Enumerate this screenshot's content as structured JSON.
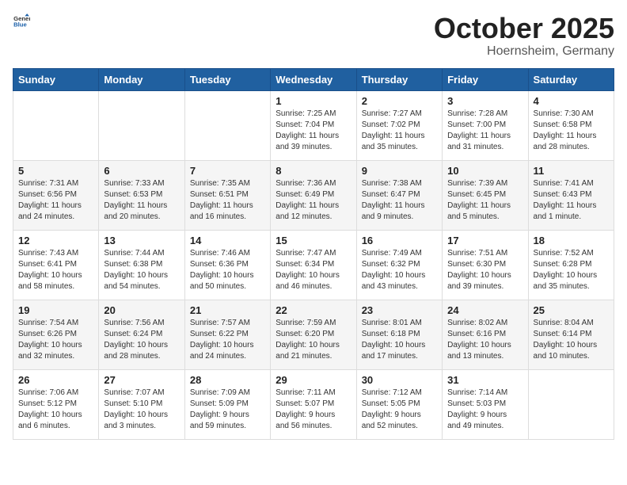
{
  "header": {
    "logo_general": "General",
    "logo_blue": "Blue",
    "month": "October 2025",
    "location": "Hoernsheim, Germany"
  },
  "weekdays": [
    "Sunday",
    "Monday",
    "Tuesday",
    "Wednesday",
    "Thursday",
    "Friday",
    "Saturday"
  ],
  "weeks": [
    [
      {
        "day": "",
        "info": ""
      },
      {
        "day": "",
        "info": ""
      },
      {
        "day": "",
        "info": ""
      },
      {
        "day": "1",
        "info": "Sunrise: 7:25 AM\nSunset: 7:04 PM\nDaylight: 11 hours\nand 39 minutes."
      },
      {
        "day": "2",
        "info": "Sunrise: 7:27 AM\nSunset: 7:02 PM\nDaylight: 11 hours\nand 35 minutes."
      },
      {
        "day": "3",
        "info": "Sunrise: 7:28 AM\nSunset: 7:00 PM\nDaylight: 11 hours\nand 31 minutes."
      },
      {
        "day": "4",
        "info": "Sunrise: 7:30 AM\nSunset: 6:58 PM\nDaylight: 11 hours\nand 28 minutes."
      }
    ],
    [
      {
        "day": "5",
        "info": "Sunrise: 7:31 AM\nSunset: 6:56 PM\nDaylight: 11 hours\nand 24 minutes."
      },
      {
        "day": "6",
        "info": "Sunrise: 7:33 AM\nSunset: 6:53 PM\nDaylight: 11 hours\nand 20 minutes."
      },
      {
        "day": "7",
        "info": "Sunrise: 7:35 AM\nSunset: 6:51 PM\nDaylight: 11 hours\nand 16 minutes."
      },
      {
        "day": "8",
        "info": "Sunrise: 7:36 AM\nSunset: 6:49 PM\nDaylight: 11 hours\nand 12 minutes."
      },
      {
        "day": "9",
        "info": "Sunrise: 7:38 AM\nSunset: 6:47 PM\nDaylight: 11 hours\nand 9 minutes."
      },
      {
        "day": "10",
        "info": "Sunrise: 7:39 AM\nSunset: 6:45 PM\nDaylight: 11 hours\nand 5 minutes."
      },
      {
        "day": "11",
        "info": "Sunrise: 7:41 AM\nSunset: 6:43 PM\nDaylight: 11 hours\nand 1 minute."
      }
    ],
    [
      {
        "day": "12",
        "info": "Sunrise: 7:43 AM\nSunset: 6:41 PM\nDaylight: 10 hours\nand 58 minutes."
      },
      {
        "day": "13",
        "info": "Sunrise: 7:44 AM\nSunset: 6:38 PM\nDaylight: 10 hours\nand 54 minutes."
      },
      {
        "day": "14",
        "info": "Sunrise: 7:46 AM\nSunset: 6:36 PM\nDaylight: 10 hours\nand 50 minutes."
      },
      {
        "day": "15",
        "info": "Sunrise: 7:47 AM\nSunset: 6:34 PM\nDaylight: 10 hours\nand 46 minutes."
      },
      {
        "day": "16",
        "info": "Sunrise: 7:49 AM\nSunset: 6:32 PM\nDaylight: 10 hours\nand 43 minutes."
      },
      {
        "day": "17",
        "info": "Sunrise: 7:51 AM\nSunset: 6:30 PM\nDaylight: 10 hours\nand 39 minutes."
      },
      {
        "day": "18",
        "info": "Sunrise: 7:52 AM\nSunset: 6:28 PM\nDaylight: 10 hours\nand 35 minutes."
      }
    ],
    [
      {
        "day": "19",
        "info": "Sunrise: 7:54 AM\nSunset: 6:26 PM\nDaylight: 10 hours\nand 32 minutes."
      },
      {
        "day": "20",
        "info": "Sunrise: 7:56 AM\nSunset: 6:24 PM\nDaylight: 10 hours\nand 28 minutes."
      },
      {
        "day": "21",
        "info": "Sunrise: 7:57 AM\nSunset: 6:22 PM\nDaylight: 10 hours\nand 24 minutes."
      },
      {
        "day": "22",
        "info": "Sunrise: 7:59 AM\nSunset: 6:20 PM\nDaylight: 10 hours\nand 21 minutes."
      },
      {
        "day": "23",
        "info": "Sunrise: 8:01 AM\nSunset: 6:18 PM\nDaylight: 10 hours\nand 17 minutes."
      },
      {
        "day": "24",
        "info": "Sunrise: 8:02 AM\nSunset: 6:16 PM\nDaylight: 10 hours\nand 13 minutes."
      },
      {
        "day": "25",
        "info": "Sunrise: 8:04 AM\nSunset: 6:14 PM\nDaylight: 10 hours\nand 10 minutes."
      }
    ],
    [
      {
        "day": "26",
        "info": "Sunrise: 7:06 AM\nSunset: 5:12 PM\nDaylight: 10 hours\nand 6 minutes."
      },
      {
        "day": "27",
        "info": "Sunrise: 7:07 AM\nSunset: 5:10 PM\nDaylight: 10 hours\nand 3 minutes."
      },
      {
        "day": "28",
        "info": "Sunrise: 7:09 AM\nSunset: 5:09 PM\nDaylight: 9 hours\nand 59 minutes."
      },
      {
        "day": "29",
        "info": "Sunrise: 7:11 AM\nSunset: 5:07 PM\nDaylight: 9 hours\nand 56 minutes."
      },
      {
        "day": "30",
        "info": "Sunrise: 7:12 AM\nSunset: 5:05 PM\nDaylight: 9 hours\nand 52 minutes."
      },
      {
        "day": "31",
        "info": "Sunrise: 7:14 AM\nSunset: 5:03 PM\nDaylight: 9 hours\nand 49 minutes."
      },
      {
        "day": "",
        "info": ""
      }
    ]
  ]
}
